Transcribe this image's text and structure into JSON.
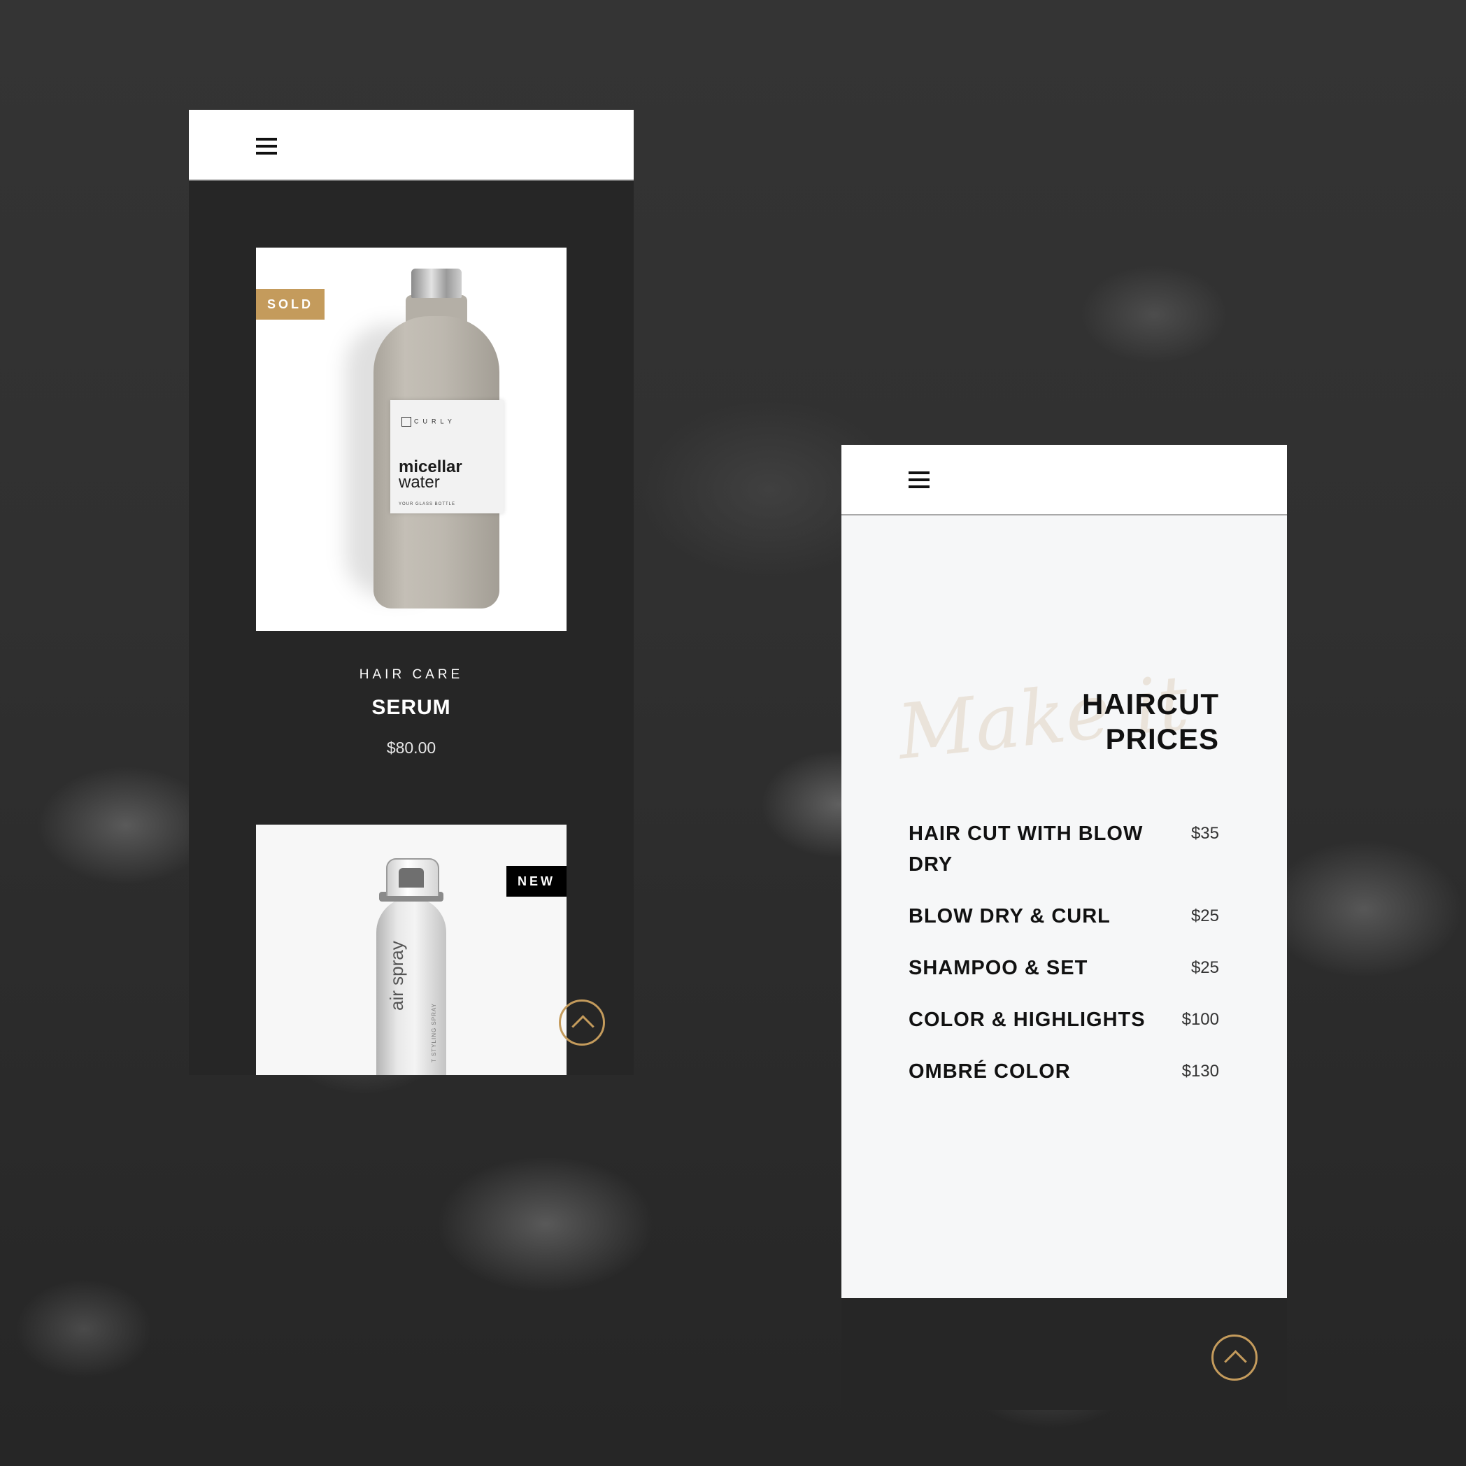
{
  "left_screen": {
    "menu_icon": "hamburger-icon",
    "products": [
      {
        "badge": "SOLD",
        "image": {
          "brand": "CURLY",
          "line1": "micellar",
          "line2": "water",
          "sub": "YOUR GLASS BOTTLE"
        },
        "category": "HAIR CARE",
        "name": "SERUM",
        "price": "$80.00"
      },
      {
        "badge": "NEW",
        "image": {
          "text": "air spray",
          "sub": "T STYLING SPRAY"
        }
      }
    ],
    "scroll_top_icon": "chevron-up-icon"
  },
  "right_screen": {
    "menu_icon": "hamburger-icon",
    "script_text": "Make it",
    "title_line1": "HAIRCUT",
    "title_line2": "PRICES",
    "prices": [
      {
        "name": "HAIR CUT WITH BLOW DRY",
        "price": "$35"
      },
      {
        "name": "BLOW DRY & CURL",
        "price": "$25"
      },
      {
        "name": "SHAMPOO & SET",
        "price": "$25"
      },
      {
        "name": "COLOR & HIGHLIGHTS",
        "price": "$100"
      },
      {
        "name": "OMBRÉ COLOR",
        "price": "$130"
      }
    ],
    "scroll_top_icon": "chevron-up-icon"
  },
  "colors": {
    "accent_gold": "#c49b5c",
    "dark": "#262626",
    "light_bg": "#f6f7f8"
  }
}
